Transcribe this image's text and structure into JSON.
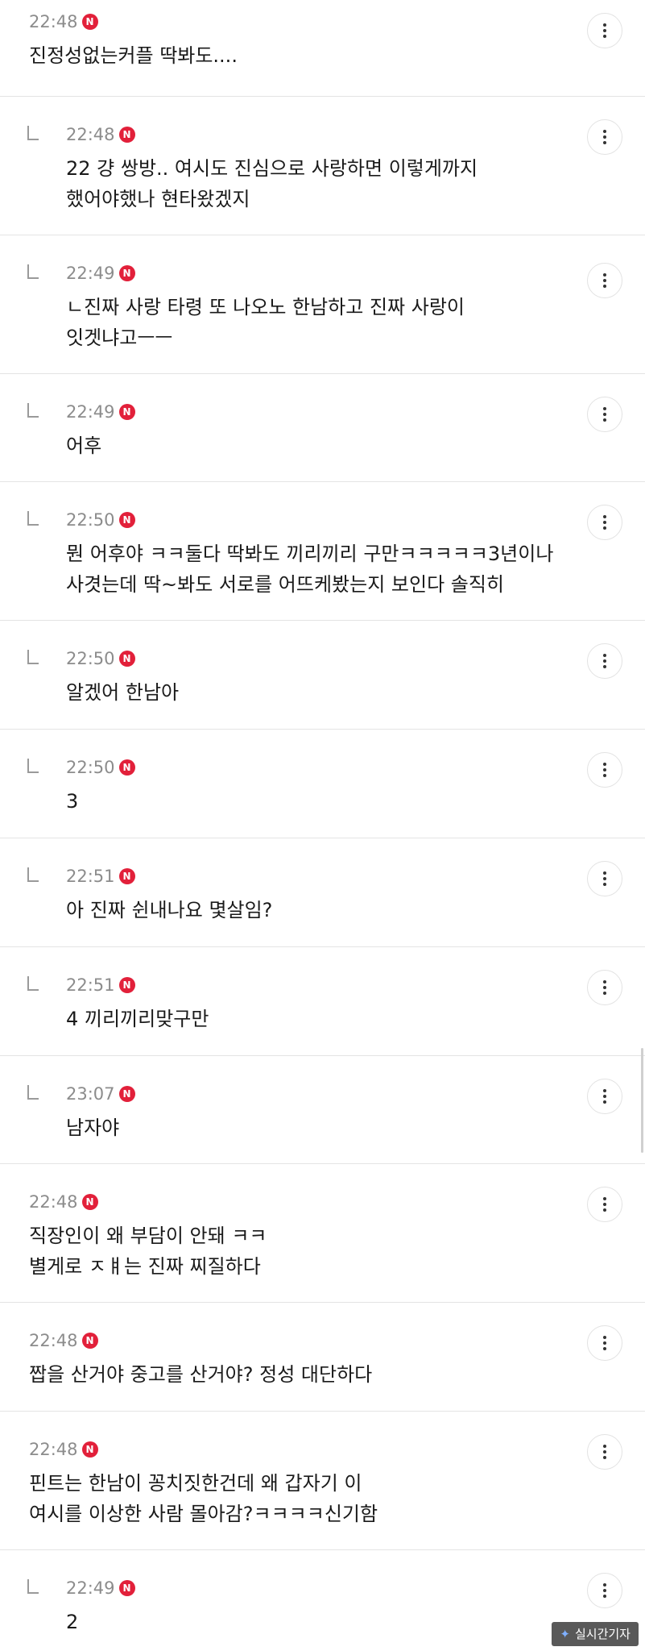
{
  "badge_label": "N",
  "badge_color": "#e2203a",
  "more_icon": "more-vertical-icon",
  "reply_icon": "reply-arrow-icon",
  "watermark": {
    "logo": "✦",
    "text": "실시간기자"
  },
  "comments": [
    {
      "reply": false,
      "time": "22:48",
      "text": "진정성없는커플 딱봐도...."
    },
    {
      "reply": true,
      "time": "22:48",
      "text": "22 걍 쌍방.. 여시도 진심으로 사랑하면 이렇게까지\n했어야했나 현타왔겠지"
    },
    {
      "reply": true,
      "time": "22:49",
      "text": "ㄴ진짜 사랑 타령 또 나오노 한남하고 진짜 사랑이\n잇겟냐고ㅡㅡ"
    },
    {
      "reply": true,
      "time": "22:49",
      "text": "어후"
    },
    {
      "reply": true,
      "time": "22:50",
      "text": "뭔 어후야 ㅋㅋ둘다 딱봐도 끼리끼리 구만ㅋㅋㅋㅋㅋ3년이나\n사겻는데 딱~봐도 서로를 어뜨케봤는지 보인다 솔직히"
    },
    {
      "reply": true,
      "time": "22:50",
      "text": "알겠어 한남아"
    },
    {
      "reply": true,
      "time": "22:50",
      "text": "3"
    },
    {
      "reply": true,
      "time": "22:51",
      "text": "아 진짜 쉰내나요 몇살임?"
    },
    {
      "reply": true,
      "time": "22:51",
      "text": "4 끼리끼리맞구만"
    },
    {
      "reply": true,
      "time": "23:07",
      "text": "남자야"
    },
    {
      "reply": false,
      "time": "22:48",
      "text": "직장인이 왜 부담이 안돼 ㅋㅋ\n별게로 ㅈㅒ는 진짜 찌질하다"
    },
    {
      "reply": false,
      "time": "22:48",
      "text": "짭을 산거야 중고를 산거야? 정성 대단하다"
    },
    {
      "reply": false,
      "time": "22:48",
      "text": "핀트는 한남이 꽁치짓한건데 왜 갑자기 이\n여시를 이상한 사람 몰아감?ㅋㅋㅋㅋ신기함"
    },
    {
      "reply": true,
      "time": "22:49",
      "text": "2"
    }
  ]
}
